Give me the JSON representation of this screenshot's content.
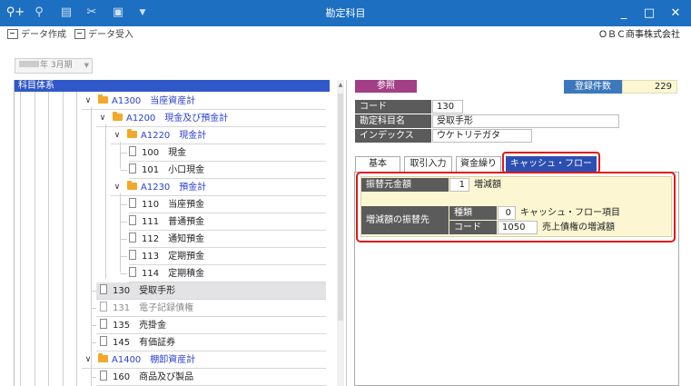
{
  "window": {
    "title": "勘定科目",
    "controls": {
      "minimize": "_",
      "maximize": "□",
      "close": "✕"
    }
  },
  "toolbar": {
    "create_label": "データ作成",
    "import_label": "データ受入",
    "company": "ＯＢＣ商事株式会社"
  },
  "period": {
    "label": "年  3月期"
  },
  "tree": {
    "header": "科目体系",
    "rows": [
      {
        "code": "A1300",
        "name": "当座資産計"
      },
      {
        "code": "A1200",
        "name": "現金及び預金計"
      },
      {
        "code": "A1220",
        "name": "現金計"
      },
      {
        "code": "100",
        "name": "現金"
      },
      {
        "code": "101",
        "name": "小口現金"
      },
      {
        "code": "A1230",
        "name": "預金計"
      },
      {
        "code": "110",
        "name": "当座預金"
      },
      {
        "code": "111",
        "name": "普通預金"
      },
      {
        "code": "112",
        "name": "通知預金"
      },
      {
        "code": "113",
        "name": "定期預金"
      },
      {
        "code": "114",
        "name": "定期積金"
      },
      {
        "code": "130",
        "name": "受取手形"
      },
      {
        "code": "131",
        "name": "電子記録債権"
      },
      {
        "code": "135",
        "name": "売掛金"
      },
      {
        "code": "145",
        "name": "有価証券"
      },
      {
        "code": "A1400",
        "name": "棚卸資産計"
      },
      {
        "code": "160",
        "name": "商品及び製品"
      }
    ]
  },
  "detail": {
    "reference_label": "参照",
    "count_label": "登録件数",
    "count_value": "229",
    "code_label": "コード",
    "code_value": "130",
    "name_label": "勘定科目名",
    "name_value": "受取手形",
    "index_label": "インデックス",
    "index_value": "ウケトリテガタ"
  },
  "tabs": [
    {
      "label": "基本"
    },
    {
      "label": "取引入力"
    },
    {
      "label": "資金繰り"
    },
    {
      "label": "キャッシュ・フロー"
    }
  ],
  "cashflow": {
    "source_label": "振替元金額",
    "source_num": "1",
    "source_text": "増減額",
    "dest_label": "増減額の振替先",
    "type_label": "種類",
    "type_num": "0",
    "type_text": "キャッシュ・フロー項目",
    "code_label": "コード",
    "code_num": "1050",
    "code_text": "売上債権の増減額"
  }
}
